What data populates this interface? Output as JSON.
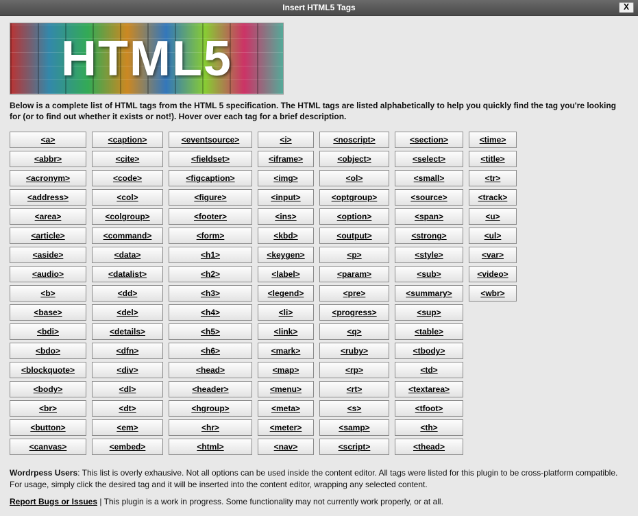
{
  "title": "Insert HTML5 Tags",
  "close_label": "X",
  "logo_text": "HTML5",
  "intro": "Below is a complete list of HTML tags from the HTML 5 specification. The HTML tags are listed alphabetically to help you quickly find the tag you're looking for (or to find out whether it exists or not!). Hover over each tag for a brief description.",
  "columns": [
    [
      "<a>",
      "<abbr>",
      "<acronym>",
      "<address>",
      "<area>",
      "<article>",
      "<aside>",
      "<audio>",
      "<b>",
      "<base>",
      "<bdi>",
      "<bdo>",
      "<blockquote>",
      "<body>",
      "<br>",
      "<button>",
      "<canvas>"
    ],
    [
      "<caption>",
      "<cite>",
      "<code>",
      "<col>",
      "<colgroup>",
      "<command>",
      "<data>",
      "<datalist>",
      "<dd>",
      "<del>",
      "<details>",
      "<dfn>",
      "<div>",
      "<dl>",
      "<dt>",
      "<em>",
      "<embed>"
    ],
    [
      "<eventsource>",
      "<fieldset>",
      "<figcaption>",
      "<figure>",
      "<footer>",
      "<form>",
      "<h1>",
      "<h2>",
      "<h3>",
      "<h4>",
      "<h5>",
      "<h6>",
      "<head>",
      "<header>",
      "<hgroup>",
      "<hr>",
      "<html>"
    ],
    [
      "<i>",
      "<iframe>",
      "<img>",
      "<input>",
      "<ins>",
      "<kbd>",
      "<keygen>",
      "<label>",
      "<legend>",
      "<li>",
      "<link>",
      "<mark>",
      "<map>",
      "<menu>",
      "<meta>",
      "<meter>",
      "<nav>"
    ],
    [
      "<noscript>",
      "<object>",
      "<ol>",
      "<optgroup>",
      "<option>",
      "<output>",
      "<p>",
      "<param>",
      "<pre>",
      "<progress>",
      "<q>",
      "<ruby>",
      "<rp>",
      "<rt>",
      "<s>",
      "<samp>",
      "<script>"
    ],
    [
      "<section>",
      "<select>",
      "<small>",
      "<source>",
      "<span>",
      "<strong>",
      "<style>",
      "<sub>",
      "<summary>",
      "<sup>",
      "<table>",
      "<tbody>",
      "<td>",
      "<textarea>",
      "<tfoot>",
      "<th>",
      "<thead>"
    ],
    [
      "<time>",
      "<title>",
      "<tr>",
      "<track>",
      "<u>",
      "<ul>",
      "<var>",
      "<video>",
      "<wbr>"
    ]
  ],
  "footer": {
    "bold_lead": "Wordrpess Users",
    "rest": ": This list is overly exhausive. Not all options can be used inside the content editor. All tags were listed for this plugin to be cross-platform compatible. For usage, simply click the desired tag and it will be inserted into the content editor, wrapping any selected content."
  },
  "report": {
    "link": "Report Bugs or Issues",
    "rest": " | This plugin is a work in progress. Some functionality may not currently work properly, or at all."
  }
}
